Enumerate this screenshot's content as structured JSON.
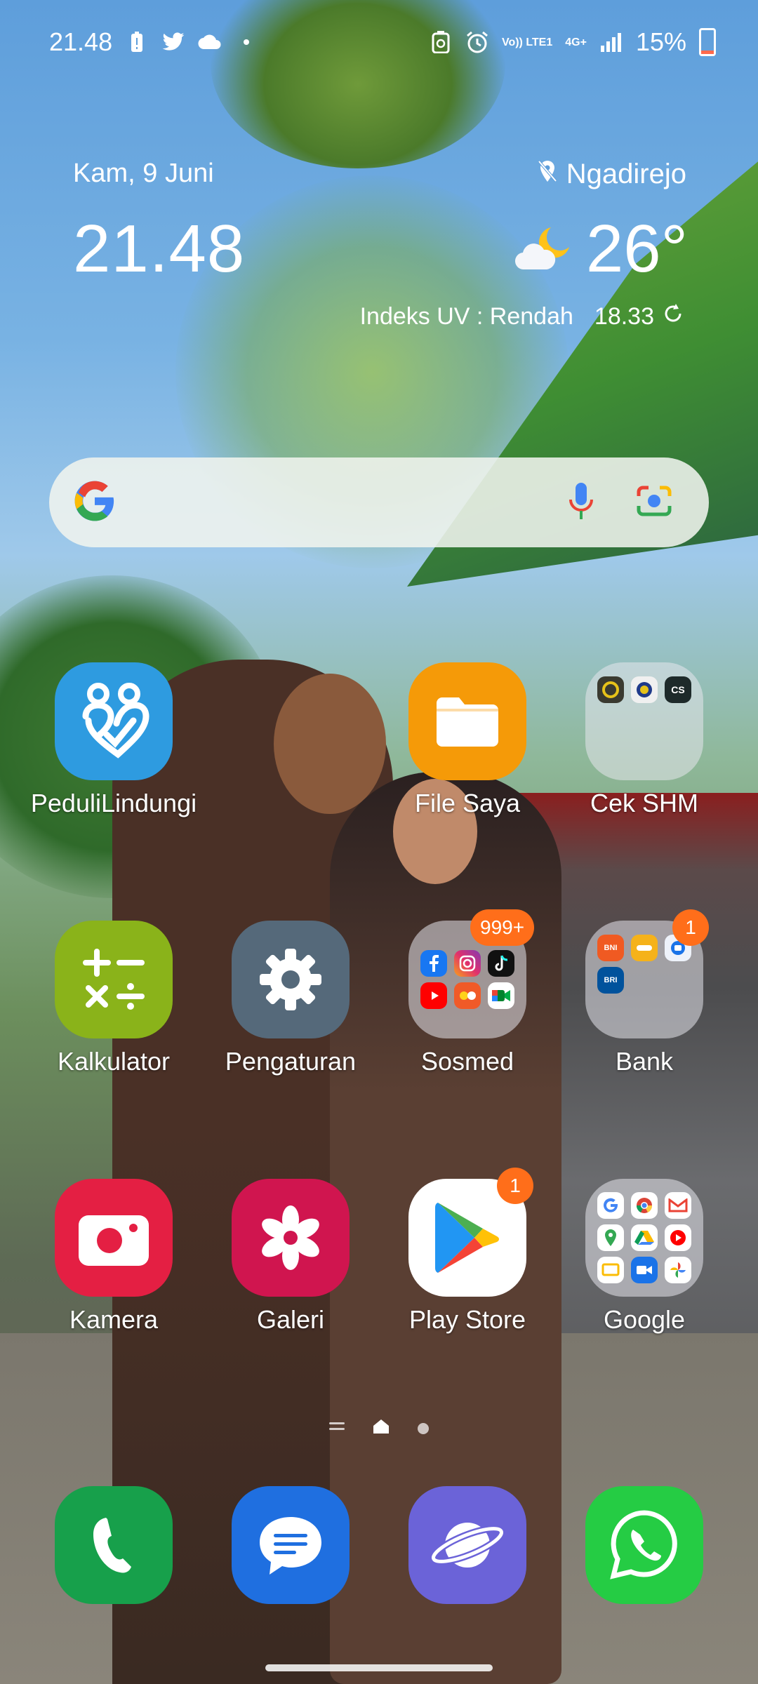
{
  "status_bar": {
    "time": "21.48",
    "left_icons": [
      "battery-alert-icon",
      "twitter-icon",
      "cloud-icon",
      "dot-icon"
    ],
    "right_icons": [
      "data-saver-icon",
      "alarm-icon",
      "volte-icon",
      "mobile-data-icon",
      "signal-icon"
    ],
    "volte_label": "Vo)) LTE1",
    "network_label": "4G+",
    "battery_percent": "15%",
    "battery_level": 0.15
  },
  "widget": {
    "date": "Kam, 9 Juni",
    "time": "21.48",
    "location": "Ngadirejo",
    "temperature": "26°",
    "uv_index": "Indeks UV : Rendah",
    "updated": "18.33"
  },
  "search": {
    "logo": "G",
    "icons": [
      "mic-icon",
      "lens-icon"
    ]
  },
  "apps": [
    {
      "label": "PeduliLindungi",
      "icon": "pedulilindungi-icon",
      "color": "#2e9be0"
    },
    {
      "label": "File Saya",
      "icon": "folder-icon",
      "color": "#f59a08"
    },
    {
      "label": "Cek SHM",
      "icon": "folder-grid",
      "color": "#e4e4ea"
    },
    {
      "label": "Kalkulator",
      "icon": "calculator-icon",
      "color": "#8ab31a"
    },
    {
      "label": "Pengaturan",
      "icon": "gear-icon",
      "color": "#55697a"
    },
    {
      "label": "Sosmed",
      "icon": "folder-grid",
      "color": "#e4e4ea",
      "badge": "999+"
    },
    {
      "label": "Bank",
      "icon": "folder-grid",
      "color": "#e4e4ea",
      "badge": "1"
    },
    {
      "label": "Kamera",
      "icon": "camera-icon",
      "color": "#e41f43"
    },
    {
      "label": "Galeri",
      "icon": "flower-icon",
      "color": "#d0154f"
    },
    {
      "label": "Play Store",
      "icon": "play-store-icon",
      "color": "#ffffff",
      "badge": "1"
    },
    {
      "label": "Google",
      "icon": "folder-grid",
      "color": "#e4e4ea"
    }
  ],
  "folder_contents": {
    "cek_shm": [
      "CS"
    ],
    "bank": [
      "BNI",
      "BRI"
    ]
  },
  "dock": [
    {
      "name": "phone",
      "icon": "phone-icon",
      "color": "#17a04b"
    },
    {
      "name": "messages",
      "icon": "messages-icon",
      "color": "#1f6fe0"
    },
    {
      "name": "internet",
      "icon": "planet-icon",
      "color": "#6b63d8"
    },
    {
      "name": "whatsapp",
      "icon": "whatsapp-icon",
      "color": "#25cc44"
    }
  ],
  "page_indicator": {
    "pages": [
      "menu",
      "home",
      "page"
    ],
    "current": 1
  }
}
